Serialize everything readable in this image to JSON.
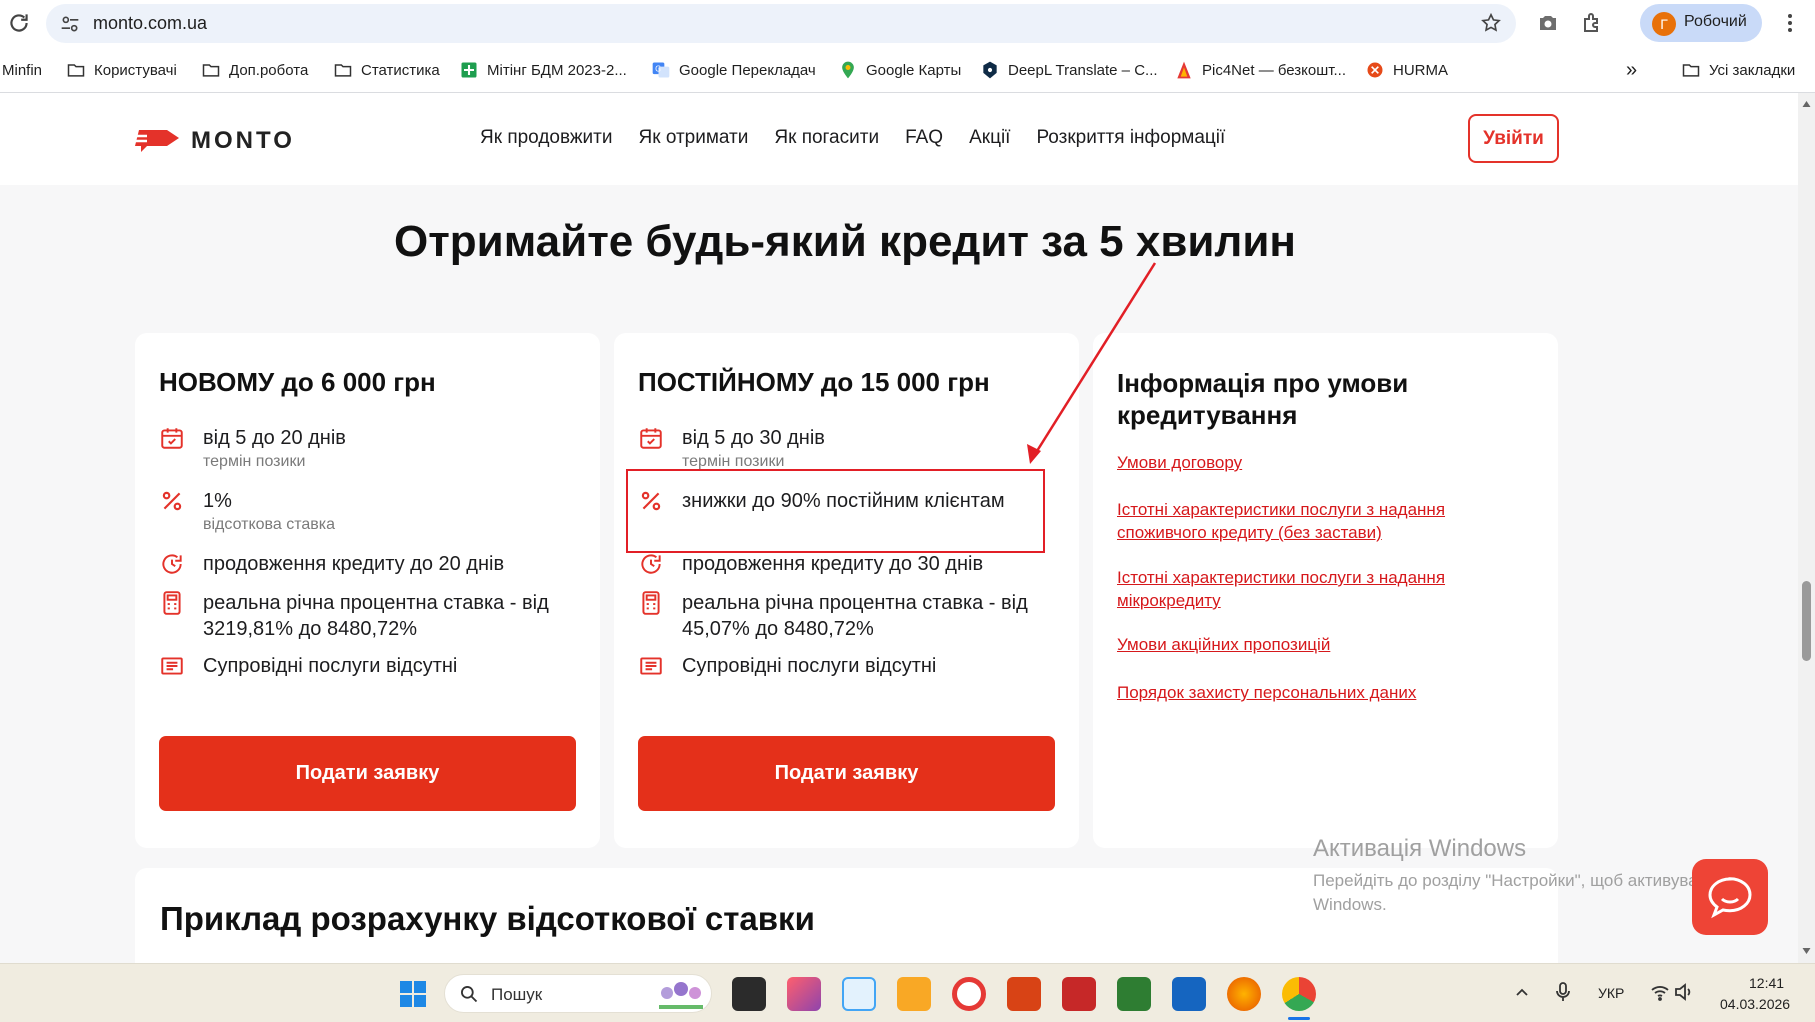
{
  "browser": {
    "url": "monto.com.ua",
    "profile_initial": "Г",
    "profile_name": "Робочий"
  },
  "bookmarks": [
    {
      "label": "Minfin"
    },
    {
      "label": "Користувачі"
    },
    {
      "label": "Доп.робота"
    },
    {
      "label": "Статистика"
    },
    {
      "label": "Мітінг БДМ 2023-2..."
    },
    {
      "label": "Google Перекладач"
    },
    {
      "label": "Google Карты"
    },
    {
      "label": "DeepL Translate – С..."
    },
    {
      "label": "Pic4Net — безкошт..."
    },
    {
      "label": "HURMA"
    }
  ],
  "bookmarks_overflow": "»",
  "bookmarks_all": "Усі закладки",
  "site": {
    "logo": "MONTO",
    "nav": [
      "Як продовжити",
      "Як отримати",
      "Як погасити",
      "FAQ",
      "Акції",
      "Розкриття інформації"
    ],
    "login": "Увійти",
    "hero_title": "Отримайте будь-який кредит за 5 хвилин"
  },
  "cards": [
    {
      "title": "НОВОМУ до 6 000 грн",
      "term": "від 5 до 20 днів",
      "term_sub": "термін позики",
      "rate": "1%",
      "rate_sub": "відсоткова ставка",
      "extension": "продовження кредиту до 20 днів",
      "apr": "реальна річна процентна ставка - від 3219,81% до 8480,72%",
      "services": "Супровідні послуги відсутні",
      "button": "Подати заявку"
    },
    {
      "title": "ПОСТІЙНОМУ до 15 000 грн",
      "term": "від 5 до 30 днів",
      "term_sub": "термін позики",
      "discount": "знижки до 90% постійним клієнтам",
      "extension": "продовження кредиту до 30 днів",
      "apr": "реальна річна процентна ставка - від 45,07% до 8480,72%",
      "services": "Супровідні послуги відсутні",
      "button": "Подати заявку"
    }
  ],
  "info": {
    "title": "Інформація про умови кредитування",
    "links": [
      "Умови договору",
      "Істотні характеристики послуги з надання споживчого кредиту (без застави)",
      "Істотні характеристики послуги з надання мікрокредиту",
      "Умови акційних пропозицій",
      "Порядок захисту персональних даних"
    ]
  },
  "example": {
    "title": "Приклад розрахунку відсоткової ставки"
  },
  "windows_activation": {
    "title": "Активація Windows",
    "text": "Перейдіть до розділу \"Настройки\", щоб активувати Windows."
  },
  "taskbar": {
    "search_placeholder": "Пошук",
    "lang": "УКР",
    "time": "12:41",
    "date": "04.03.2026"
  },
  "colors": {
    "accent": "#e4301a",
    "link": "#d6181b",
    "annotation": "#e21f26"
  }
}
